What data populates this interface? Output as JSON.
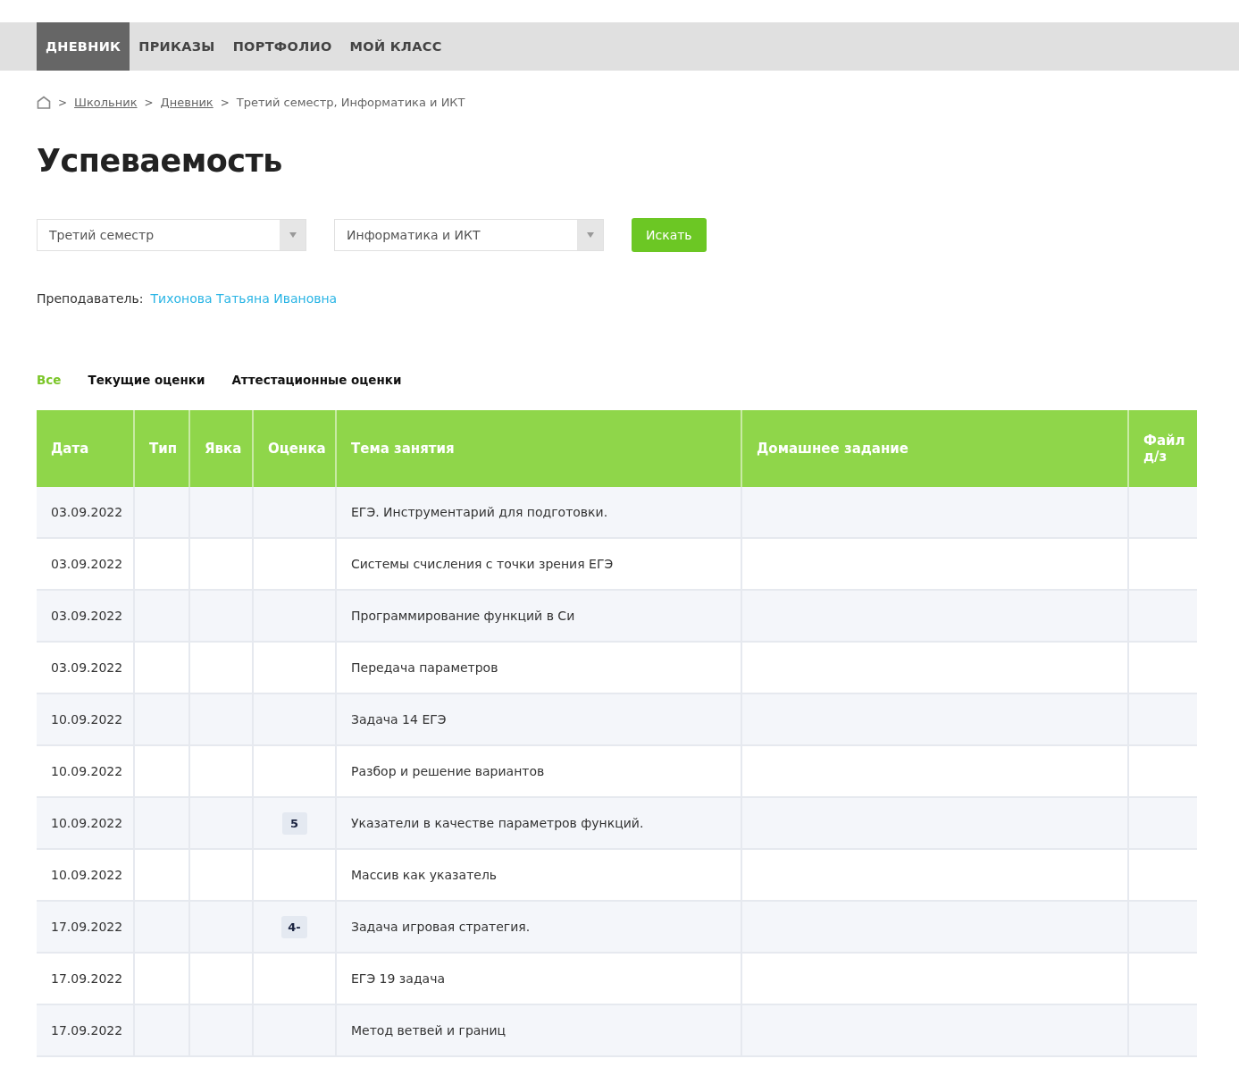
{
  "nav": [
    {
      "label": "ДНЕВНИК",
      "selected": true
    },
    {
      "label": "ПРИКАЗЫ",
      "selected": false
    },
    {
      "label": "ПОРТФОЛИО",
      "selected": false
    },
    {
      "label": "МОЙ КЛАСС",
      "selected": false
    }
  ],
  "breadcrumbs": [
    {
      "label": "Школьник",
      "kind": "link"
    },
    {
      "label": "Дневник",
      "kind": "link"
    },
    {
      "label": "Третий семестр, Информатика и ИКТ",
      "kind": "current"
    }
  ],
  "breadcrumb_separator": ">",
  "title": "Успеваемость",
  "filters": {
    "period": "Третий семестр",
    "subject": "Информатика и ИКТ",
    "search_button": "Искать"
  },
  "teacher": {
    "label": "Преподаватель:",
    "name": "Тихонова Татьяна Ивановна"
  },
  "tabs": [
    {
      "label": "Все",
      "selected": true
    },
    {
      "label": "Текущие оценки",
      "selected": false
    },
    {
      "label": "Аттестационные оценки",
      "selected": false
    }
  ],
  "table": {
    "columns": [
      "Дата",
      "Тип",
      "Явка",
      "Оценка",
      "Тема занятия",
      "Домашнее задание",
      "Файл д/з"
    ],
    "rows": [
      {
        "date": "03.09.2022",
        "grade": "",
        "topic": "ЕГЭ. Инструментарий для подготовки."
      },
      {
        "date": "03.09.2022",
        "grade": "",
        "topic": "Системы счисления с точки зрения ЕГЭ"
      },
      {
        "date": "03.09.2022",
        "grade": "",
        "topic": "Программирование функций в Си"
      },
      {
        "date": "03.09.2022",
        "grade": "",
        "topic": "Передача параметров"
      },
      {
        "date": "10.09.2022",
        "grade": "",
        "topic": "Задача 14 ЕГЭ"
      },
      {
        "date": "10.09.2022",
        "grade": "",
        "topic": "Разбор и решение вариантов"
      },
      {
        "date": "10.09.2022",
        "grade": "5",
        "topic": "Указатели в качестве параметров функций."
      },
      {
        "date": "10.09.2022",
        "grade": "",
        "topic": "Массив как указатель"
      },
      {
        "date": "17.09.2022",
        "grade": "4-",
        "topic": "Задача игровая стратегия."
      },
      {
        "date": "17.09.2022",
        "grade": "",
        "topic": "ЕГЭ 19 задача"
      },
      {
        "date": "17.09.2022",
        "grade": "",
        "topic": "Метод ветвей и границ"
      }
    ]
  }
}
